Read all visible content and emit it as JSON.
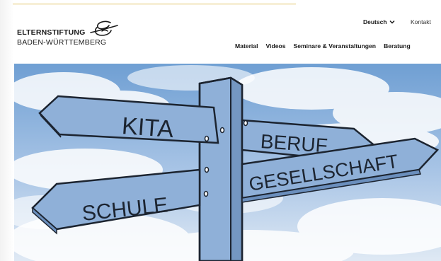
{
  "brand": {
    "name_line1": "ELTERNSTIFTUNG",
    "name_line2": "BADEN-WÜRTTEMBERG"
  },
  "utility_nav": {
    "language": "Deutsch",
    "contact": "Kontakt"
  },
  "main_nav": {
    "items": [
      {
        "label": "Material"
      },
      {
        "label": "Videos"
      },
      {
        "label": "Seminare & Veranstaltungen"
      },
      {
        "label": "Beratung"
      }
    ]
  },
  "hero": {
    "signs": {
      "kita": "KITA",
      "beruf": "BERUF",
      "schule": "SCHULE",
      "gesellschaft": "GESELLSCHAFT"
    },
    "colors": {
      "sign_fill": "#8fb0d8",
      "sign_stroke": "#1c2430",
      "sky_top": "#6f9fd3",
      "sky_bottom": "#dfe9f4"
    }
  },
  "icons": {
    "language_chevron": "chevron-down-icon",
    "logo_mark": "logo-mark-icon"
  }
}
